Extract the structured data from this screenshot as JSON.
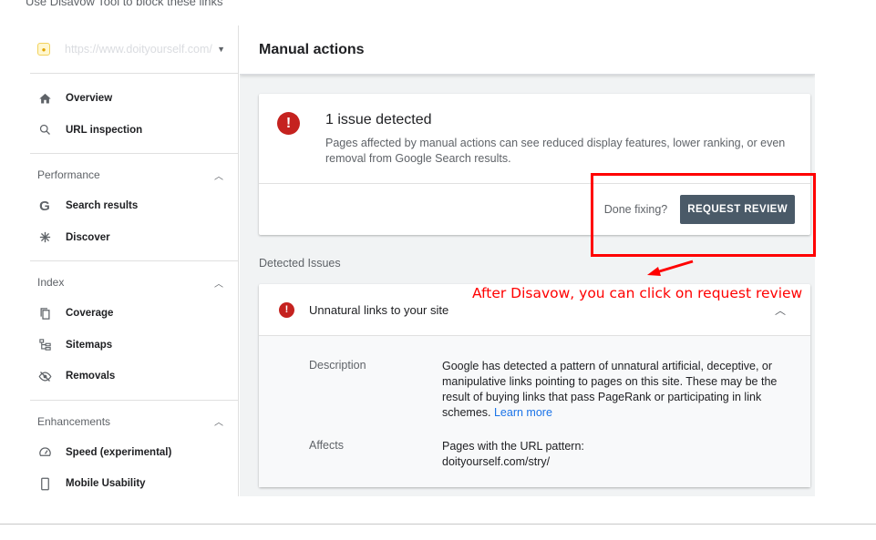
{
  "top_strip_text": "Use Disavow Tool to block these links",
  "sidebar": {
    "property_url": "https://www.doityourself.com/",
    "groups": [
      {
        "header": "",
        "items": [
          {
            "label": "Overview",
            "icon": "home-icon"
          },
          {
            "label": "URL inspection",
            "icon": "search-icon"
          }
        ]
      },
      {
        "header": "Performance",
        "items": [
          {
            "label": "Search results",
            "icon": "google-g-icon"
          },
          {
            "label": "Discover",
            "icon": "asterisk-icon"
          }
        ]
      },
      {
        "header": "Index",
        "items": [
          {
            "label": "Coverage",
            "icon": "copy-icon"
          },
          {
            "label": "Sitemaps",
            "icon": "sitemap-icon"
          },
          {
            "label": "Removals",
            "icon": "eye-off-icon"
          }
        ]
      },
      {
        "header": "Enhancements",
        "items": [
          {
            "label": "Speed (experimental)",
            "icon": "speedometer-icon"
          },
          {
            "label": "Mobile Usability",
            "icon": "phone-icon"
          }
        ]
      }
    ]
  },
  "main": {
    "page_title": "Manual actions",
    "issue_card": {
      "title": "1 issue detected",
      "description": "Pages affected by manual actions can see reduced display features, lower ranking, or even removal from Google Search results.",
      "done_text": "Done fixing?",
      "button_label": "REQUEST REVIEW"
    },
    "detected_label": "Detected Issues",
    "detail_card": {
      "title": "Unnatural links to your site",
      "description_label": "Description",
      "description_text": "Google has detected a pattern of unnatural artificial, deceptive, or manipulative links pointing to pages on this site. These may be the result of buying links that pass PageRank or participating in link schemes.",
      "learn_more": "Learn more",
      "affects_label": "Affects",
      "affects_line1": "Pages with the URL pattern:",
      "affects_line2": "doityourself.com/stry/"
    }
  },
  "annotation": {
    "text": "After Disavow, you can click on request review",
    "color": "#ff0000"
  },
  "colors": {
    "error_red": "#c5221f",
    "button_bg": "#4a5a68",
    "link_blue": "#1a73e8"
  }
}
